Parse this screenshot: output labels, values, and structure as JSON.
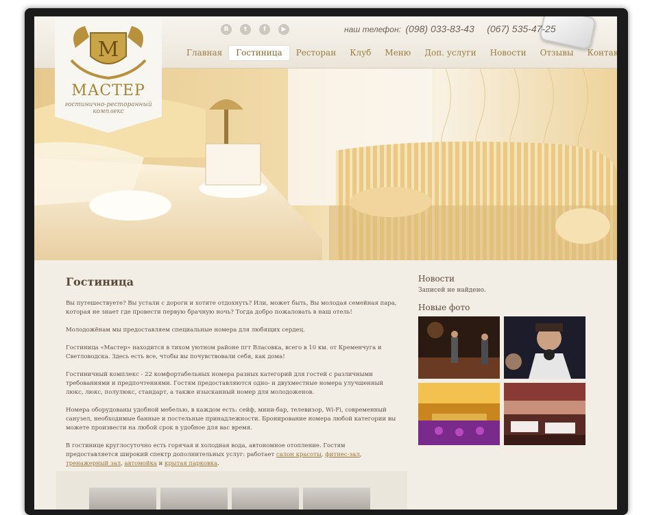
{
  "header": {
    "phone_label": "наш телефон:",
    "phone_1": "(098) 033-83-43",
    "phone_2": "(067) 535-47-25",
    "socials": [
      {
        "icon": "vkontakte-icon",
        "glyph": "B"
      },
      {
        "icon": "twitter-icon",
        "glyph": "t"
      },
      {
        "icon": "facebook-icon",
        "glyph": "f"
      },
      {
        "icon": "youtube-icon",
        "glyph": "▶"
      }
    ]
  },
  "logo": {
    "title": "МАСТЕР",
    "subtitle": "гостинично-ресторанный комплекс",
    "monogram": "М"
  },
  "nav": {
    "items": [
      "Главная",
      "Гостиница",
      "Ресторан",
      "Клуб",
      "Меню",
      "Доп. услуги",
      "Новости",
      "Отзывы",
      "Контакты"
    ],
    "active": "Гостиница"
  },
  "main": {
    "title": "Гостиница",
    "paragraphs": [
      "Вы путешествуете? Вы устали с дороги и хотите отдохнуть? Или, может быть, Вы молодая семейная пара, которая не знает где провести первую брачную ночь? Тогда добро пожаловать в наш отель!",
      "Молодожёнам мы предоставляем специальные номера для любящих сердец.",
      "Гостиница «Мастер» находится в тихом уютном районе пгт Власовка, всего в 10 км. от Кременчуга и Светловодска. Здесь есть все, чтобы вы почувствовали себя, как дома!",
      "Гостиничный комплекс - 22 комфортабельных номера разных категорий для гостей с различными требованиями и предпочтениями. Гостям предоставляются одно- и двухместные номера улучшенный люкс, люкс, полулюкс, стандарт, а также изысканный номер для молодоженов.",
      "Номера оборудованы удобной мебелью, в каждом есть: сейф, мини-бар, телевизор, Wi-Fi, современный санузел, необходимые банные и постельные принадлежности. Бронирование номера любой категории вы можете произвести на любой срок в удобное для вас время."
    ],
    "services_intro": "В гостинице круглосуточно есть горячая и холодная вода, автономное отопление. Гостям предоставляется широкий спектр дополнительных услуг: работает",
    "services_links": [
      "салон красоты",
      "фитнес-зал",
      "тренажерный зал",
      "автомойка",
      "крытая парковка"
    ],
    "sep_comma": ",",
    "sep_and": "и",
    "end_dot": "."
  },
  "sidebar": {
    "news_title": "Новости",
    "news_empty": "Записей не найдено.",
    "photos_title": "Новые фото"
  },
  "colors": {
    "accent_gold": "#a68234",
    "link": "#9a7432",
    "page_bg": "#f2eee6"
  }
}
